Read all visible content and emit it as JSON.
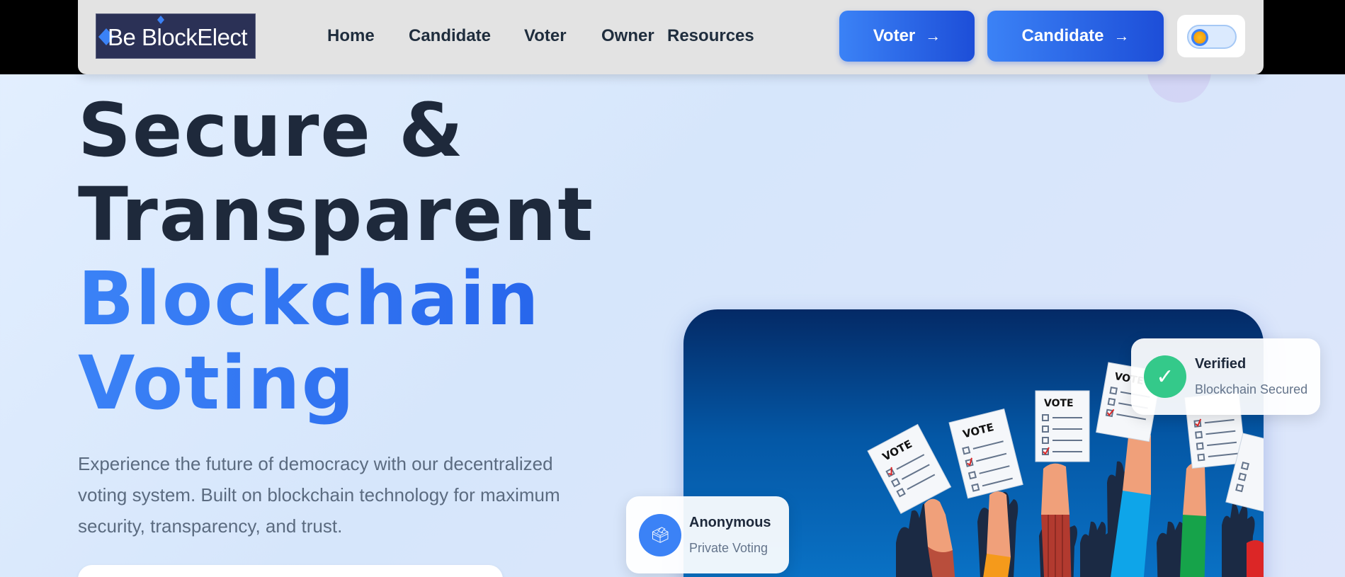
{
  "nav": {
    "logo_text": "Be BlockElect",
    "links": [
      "Home",
      "Candidate",
      "Voter",
      "Owner",
      "Resources"
    ],
    "voter_button": "Voter",
    "candidate_button": "Candidate",
    "arrow": "→"
  },
  "hero": {
    "title_line1": "Secure &",
    "title_line2": "Transparent",
    "title_line3": "Blockchain",
    "title_line4": "Voting",
    "subtitle": "Experience the future of democracy with our decentralized voting system. Built on blockchain technology for maximum security, transparency, and trust."
  },
  "badges": {
    "verified_icon": "✓",
    "verified_title": "Verified",
    "verified_subtitle": "Blockchain Secured",
    "anon_icon": "🗳",
    "anon_title": "Anonymous",
    "anon_subtitle": "Private Voting"
  },
  "illustration": {
    "ballot_label": "VOTE"
  },
  "colors": {
    "accent": "#3b82f6",
    "accent_dark": "#1d4ed8",
    "heading": "#1e293b",
    "verified_green": "#34c98a"
  },
  "icons": {
    "theme_toggle": "sun-toggle-icon",
    "button_arrow": "arrow-right-icon",
    "verified": "check-icon",
    "anonymous": "ballot-box-icon"
  }
}
